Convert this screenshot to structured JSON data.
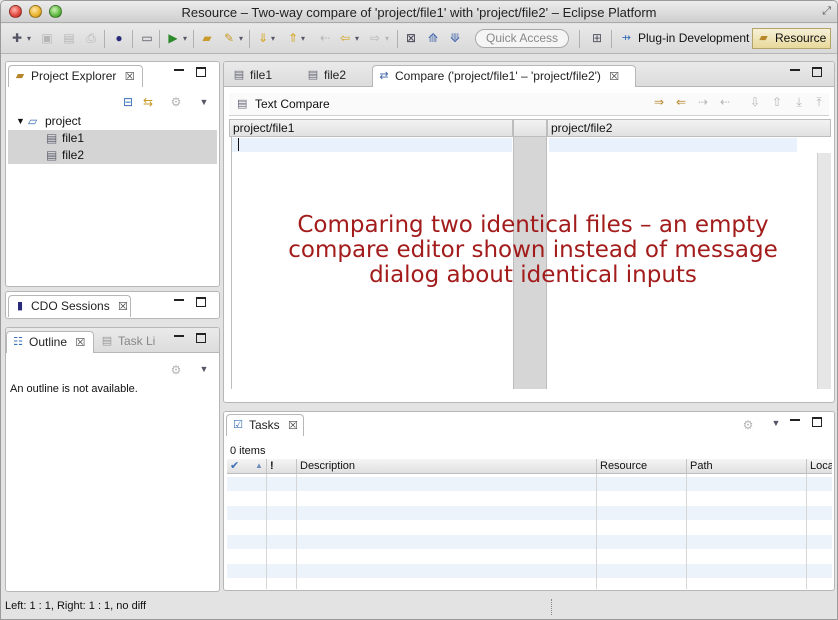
{
  "window": {
    "title": "Resource – Two-way compare of 'project/file1' with 'project/file2' – Eclipse Platform"
  },
  "toolbar": {
    "quick_access_placeholder": "Quick Access",
    "perspectives": [
      {
        "label": "Plug-in Development",
        "icon": "plugin-perspective-icon"
      },
      {
        "label": "Resource",
        "icon": "resource-perspective-icon",
        "active": true
      }
    ]
  },
  "project_explorer": {
    "title": "Project Explorer",
    "tree": [
      {
        "label": "project",
        "icon": "folder-icon",
        "depth": 0,
        "expanded": true
      },
      {
        "label": "file1",
        "icon": "file-icon",
        "depth": 1,
        "selected": true
      },
      {
        "label": "file2",
        "icon": "file-icon",
        "depth": 1,
        "selected": true
      }
    ]
  },
  "cdo_sessions": {
    "title": "CDO Sessions"
  },
  "outline": {
    "tabs": [
      {
        "label": "Outline",
        "active": true
      },
      {
        "label": "Task Li",
        "active": false
      }
    ],
    "message": "An outline is not available."
  },
  "editor": {
    "tabs": [
      {
        "label": "file1",
        "active": false
      },
      {
        "label": "file2",
        "active": false
      },
      {
        "label": "Compare ('project/file1' – 'project/file2')",
        "active": true
      }
    ],
    "compare_title": "Text Compare",
    "left_label": "project/file1",
    "right_label": "project/file2",
    "annotation": "Comparing two identical files – an empty compare editor shown instead of message dialog about identical inputs"
  },
  "tasks": {
    "title": "Tasks",
    "count_text": "0 items",
    "columns": [
      "!",
      "Description",
      "Resource",
      "Path",
      "Loca"
    ]
  },
  "status_bar": {
    "text": "Left: 1 : 1, Right: 1 : 1, no diff"
  }
}
